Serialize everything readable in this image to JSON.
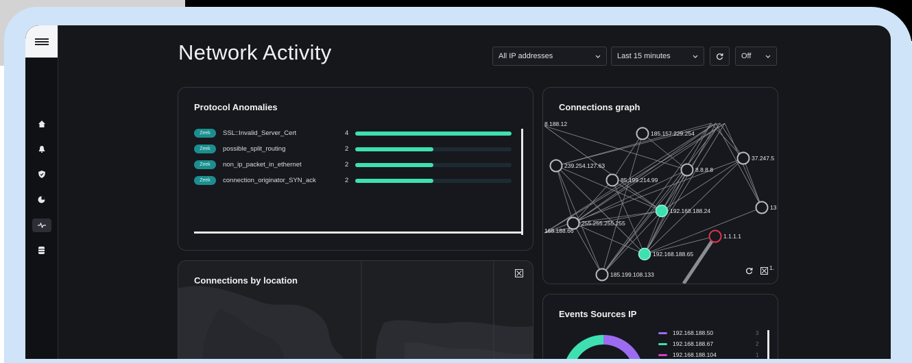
{
  "page": {
    "title": "Network Activity"
  },
  "toolbar": {
    "ip_filter": "All IP addresses",
    "time_range": "Last 15 minutes",
    "auto_refresh": "Off"
  },
  "protocol_anomalies": {
    "title": "Protocol Anomalies",
    "rows": [
      {
        "tag": "Zeek",
        "name": "SSL::Invalid_Server_Cert",
        "count": "4",
        "fraction": 1.0
      },
      {
        "tag": "Zeek",
        "name": "possible_split_routing",
        "count": "2",
        "fraction": 0.5
      },
      {
        "tag": "Zeek",
        "name": "non_ip_packet_in_ethernet",
        "count": "2",
        "fraction": 0.5
      },
      {
        "tag": "Zeek",
        "name": "connection_originator_SYN_ack",
        "count": "2",
        "fraction": 0.5
      }
    ]
  },
  "connections_graph": {
    "title": "Connections graph",
    "nodes": [
      {
        "label": "8.188.12"
      },
      {
        "label": "185.157.229.254"
      },
      {
        "label": "37.247.5"
      },
      {
        "label": "239.254.127.63"
      },
      {
        "label": "85.199.214.99"
      },
      {
        "label": "8.8.8.8"
      },
      {
        "label": "13"
      },
      {
        "label": "192.168.188.24"
      },
      {
        "label": "255.255.255.255"
      },
      {
        "label": "1.1.1.1"
      },
      {
        "label": "168.188.66"
      },
      {
        "label": "192.168.188.65"
      },
      {
        "label": "185.199.108.133"
      },
      {
        "label": "1."
      }
    ]
  },
  "connections_location": {
    "title": "Connections by location"
  },
  "event_sources": {
    "title": "Events Sources IP",
    "legend": [
      {
        "label": "192.168.188.50",
        "color": "#9b6cf0",
        "value": "3"
      },
      {
        "label": "192.168.188.67",
        "color": "#3ee0b2",
        "value": "2"
      },
      {
        "label": "192.168.188.104",
        "color": "#d63cc8",
        "value": "1"
      }
    ]
  },
  "colors": {
    "accent": "#3ee0b2",
    "alert": "#e0344b",
    "background": "#15171b"
  }
}
